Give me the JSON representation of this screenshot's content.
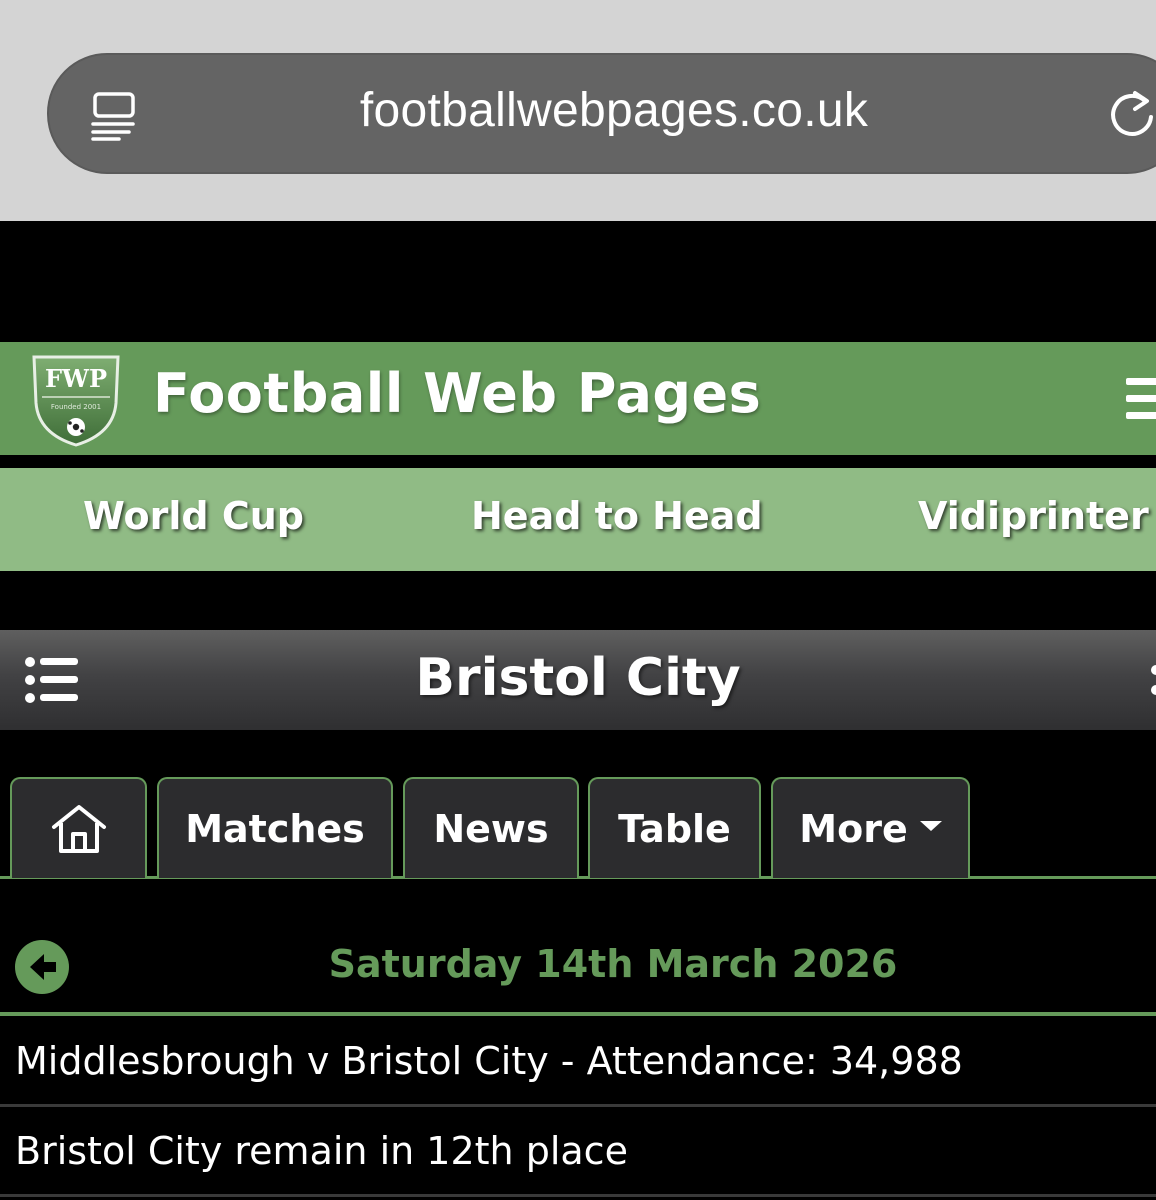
{
  "browser": {
    "url": "footballwebpages.co.uk"
  },
  "site": {
    "title": "Football Web Pages",
    "logo_text": "FWP",
    "logo_subtext": "Founded 2001"
  },
  "nav": {
    "items": [
      {
        "label": "World Cup"
      },
      {
        "label": "Head to Head"
      },
      {
        "label": "Vidiprinter"
      }
    ]
  },
  "team": {
    "name": "Bristol City"
  },
  "tabs": {
    "home_icon": "home-icon",
    "items": [
      {
        "label": "Matches"
      },
      {
        "label": "News"
      },
      {
        "label": "Table"
      },
      {
        "label": "More"
      }
    ]
  },
  "news": {
    "date": "Saturday 14th March 2026",
    "items": [
      {
        "text": "Middlesbrough v Bristol City - Attendance: 34,988"
      },
      {
        "text": "Bristol City remain in 12th place"
      }
    ]
  },
  "colors": {
    "brand_green": "#659a5a",
    "nav_green": "#90bb85",
    "background": "#000000"
  }
}
